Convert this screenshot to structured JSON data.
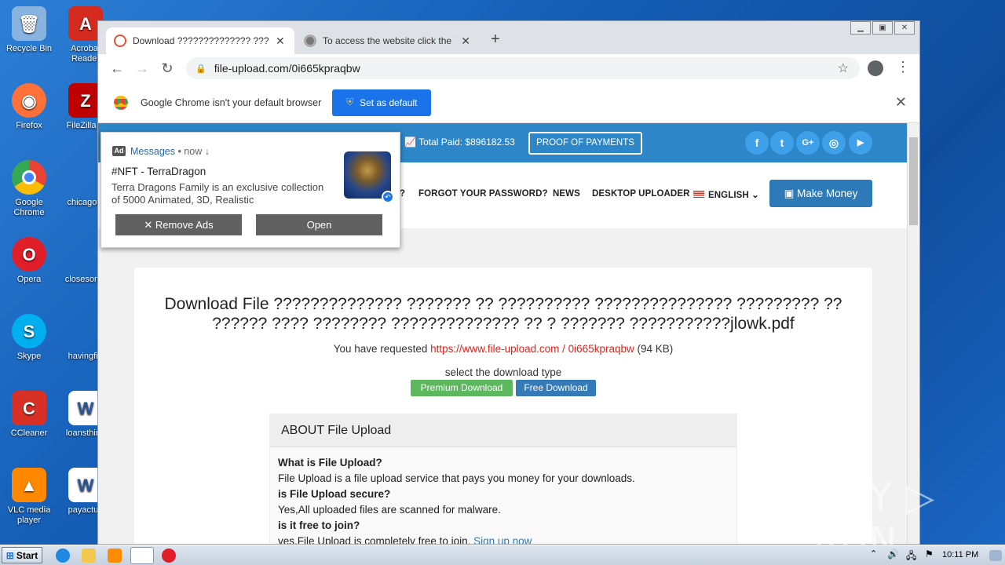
{
  "desktop": {
    "icons": [
      {
        "label": "Recycle Bin",
        "icon": "recycle-bin-icon",
        "color": "#8ab4e0"
      },
      {
        "label": "Acrobat Reader",
        "icon": "acrobat-icon",
        "color": "#d52b1e"
      },
      {
        "label": "Firefox",
        "icon": "firefox-icon",
        "color": "#ff7139"
      },
      {
        "label": "FileZilla C",
        "icon": "filezilla-icon",
        "color": "#bf0000"
      },
      {
        "label": "Google Chrome",
        "icon": "chrome-icon",
        "color": "#4285f4"
      },
      {
        "label": "chicagoto",
        "icon": "file-icon",
        "color": "#d8d8d8"
      },
      {
        "label": "Opera",
        "icon": "opera-icon",
        "color": "#e01e2a"
      },
      {
        "label": "closesome",
        "icon": "file-icon",
        "color": "#d8d8d8"
      },
      {
        "label": "Skype",
        "icon": "skype-icon",
        "color": "#00aff0"
      },
      {
        "label": "havingfitr",
        "icon": "file-icon",
        "color": "#d8d8d8"
      },
      {
        "label": "CCleaner",
        "icon": "ccleaner-icon",
        "color": "#d93025"
      },
      {
        "label": "loansthing",
        "icon": "word-doc-icon",
        "color": "#2b579a"
      },
      {
        "label": "VLC media player",
        "icon": "vlc-icon",
        "color": "#ff8800"
      },
      {
        "label": "payactua",
        "icon": "word-doc-icon",
        "color": "#2b579a"
      }
    ]
  },
  "browser": {
    "tabs": [
      {
        "title": "Download ?????????????? ??????? ???",
        "active": true
      },
      {
        "title": "To access the website click the \"Allow\"",
        "active": false
      }
    ],
    "new_tab": "+",
    "url": "file-upload.com/0i665kpraqbw",
    "infobar": {
      "message": "Google Chrome isn't your default browser",
      "button": "Set as default"
    }
  },
  "site": {
    "total_paid": "Total Paid: $896182.53",
    "proof_button": "PROOF OF PAYMENTS",
    "social": [
      "f",
      "t",
      "G+",
      "◎",
      "▶"
    ],
    "nav": {
      "partial": "?",
      "forgot": "FORGOT YOUR PASSWORD?",
      "news": "NEWS",
      "desktop_uploader": "DESKTOP UPLOADER",
      "language": "ENGLISH"
    },
    "make_money": "Make Money",
    "download_title": "Download File ?????????????? ??????? ?? ?????????? ??????????????? ????????? ?? ?????? ???? ???????? ?????????????? ?? ? ??????? ???????????jlowk.pdf",
    "requested_prefix": "You have requested ",
    "requested_link": "https://www.file-upload.com / 0i665kpraqbw",
    "requested_size": " (94 KB)",
    "select_type": "select the download type",
    "premium_button": "Premium Download",
    "free_button": "Free Download",
    "about": {
      "heading": "ABOUT File Upload",
      "faq": [
        {
          "q": "What is File Upload?",
          "a": "File Upload is a file upload service that pays you money for your downloads."
        },
        {
          "q": "is File Upload secure?",
          "a": "Yes,All uploaded files are scanned for malware."
        },
        {
          "q": "is it free to join?",
          "a": "yes,File Upload is completely free to join. "
        }
      ],
      "signup_link": "Sign up now"
    }
  },
  "notification": {
    "ad_tag": "Ad",
    "source": "Messages",
    "time": " • now ↓",
    "title": "#NFT - TerraDragon",
    "body": "Terra Dragons Family is an exclusive collection of 5000 Animated, 3D, Realistic",
    "remove_ads": "Remove Ads",
    "open": "Open"
  },
  "watermark": "ANY ▷ RUN",
  "taskbar": {
    "start": "Start",
    "clock": "10:11 PM"
  }
}
